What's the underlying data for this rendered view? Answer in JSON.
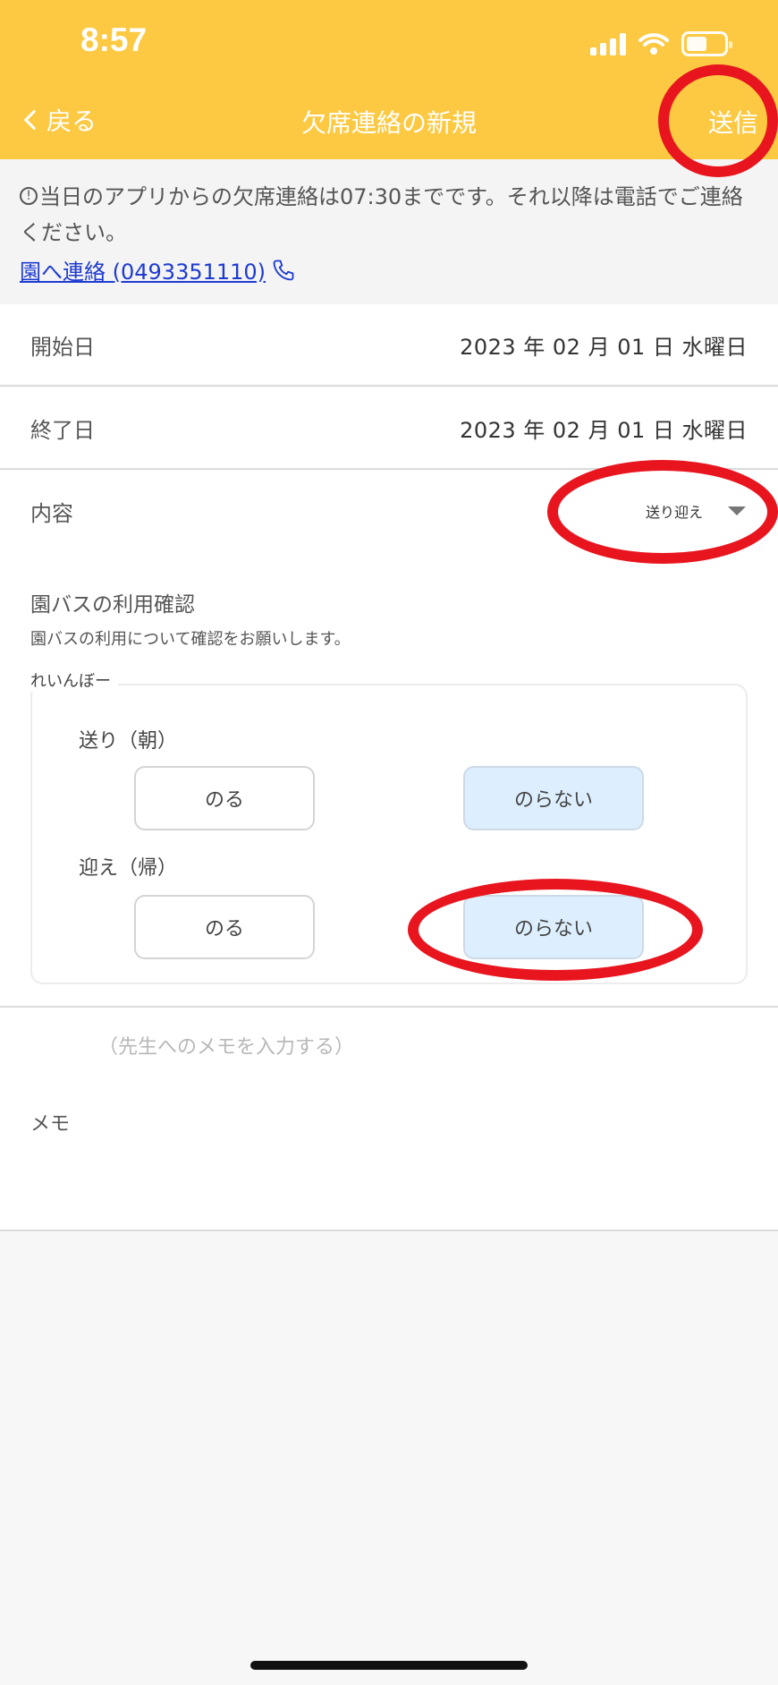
{
  "status_bar": {
    "time": "8:57"
  },
  "nav": {
    "back_label": "戻る",
    "title": "欠席連絡の新規",
    "send_label": "送信"
  },
  "notice": {
    "text": "当日のアプリからの欠席連絡は07:30までです。それ以降は電話でご連絡ください。",
    "info_glyph": "!",
    "contact_link": "園へ連絡 (0493351110)"
  },
  "form": {
    "start_date": {
      "label": "開始日",
      "value": "2023 年 02 月 01 日  水曜日"
    },
    "end_date": {
      "label": "終了日",
      "value": "2023 年 02 月 01 日  水曜日"
    },
    "content": {
      "label": "内容",
      "selected": "送り迎え"
    }
  },
  "bus": {
    "title": "園バスの利用確認",
    "subtitle": "園バスの利用について確認をお願いします。",
    "child_name": "れいんぼー",
    "morning": {
      "label": "送り（朝）",
      "ride_label": "のる",
      "no_ride_label": "のらない",
      "selected": "のらない"
    },
    "evening": {
      "label": "迎え（帰）",
      "ride_label": "のる",
      "no_ride_label": "のらない",
      "selected": "のらない"
    }
  },
  "memo": {
    "label": "メモ",
    "placeholder": "（先生へのメモを入力する）",
    "value": ""
  },
  "colors": {
    "header": "#fdc942",
    "link": "#1e3bd1",
    "selected_button": "#ddefff",
    "annotation": "#e8151f"
  },
  "icons": [
    "chevron-left-icon",
    "info-icon",
    "phone-icon",
    "chevron-down-icon",
    "signal-icon",
    "wifi-icon",
    "battery-icon"
  ]
}
